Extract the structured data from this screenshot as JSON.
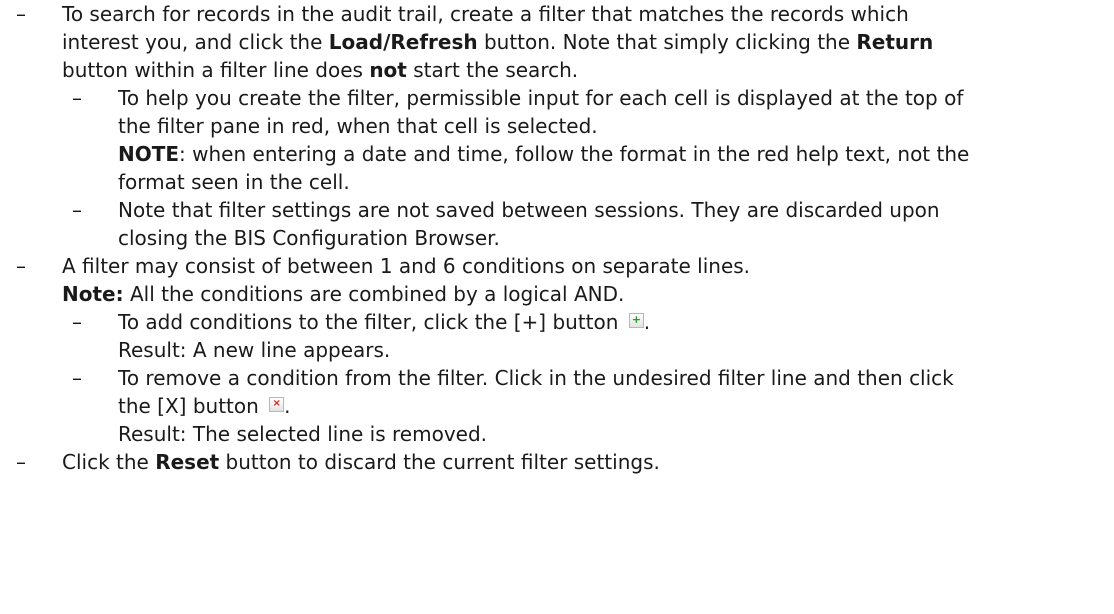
{
  "bullet": "–",
  "items": [
    {
      "lines": [
        [
          "To search for records in the audit trail, create a filter that matches the records which"
        ],
        [
          "interest you, and click the ",
          {
            "b": "Load/Refresh"
          },
          " button. Note that simply clicking the ",
          {
            "b": "Return"
          }
        ],
        [
          "button within a filter line does ",
          {
            "b": "not"
          },
          " start the search."
        ]
      ],
      "sub": [
        {
          "lines": [
            [
              "To help you create the filter, permissible input for each cell is displayed at the top of"
            ],
            [
              "the filter pane in red, when that cell is selected."
            ],
            [
              {
                "b": "NOTE"
              },
              ": when entering a date and time, follow the format in the red help text, not the"
            ],
            [
              "format seen in the cell."
            ]
          ]
        },
        {
          "lines": [
            [
              "Note that filter settings are not saved between sessions. They are discarded upon"
            ],
            [
              "closing the BIS Configuration Browser."
            ]
          ]
        }
      ]
    },
    {
      "lines": [
        [
          "A filter may consist of between 1 and 6 conditions on separate lines."
        ],
        [
          {
            "b": "Note:"
          },
          " All the conditions are combined by a logical AND."
        ]
      ],
      "sub": [
        {
          "lines": [
            [
              "To add conditions to the filter, click the [+] button ",
              {
                "icon": "plus"
              },
              "."
            ],
            [
              "Result: A new line appears."
            ]
          ]
        },
        {
          "lines": [
            [
              "To remove a condition from the filter. Click in the undesired filter line and then click"
            ],
            [
              "the [X] button ",
              {
                "icon": "cross"
              },
              "."
            ],
            [
              "Result: The selected line is removed."
            ]
          ]
        }
      ]
    },
    {
      "lines": [
        [
          "Click the ",
          {
            "b": "Reset"
          },
          " button to discard the current filter settings."
        ]
      ],
      "sub": []
    }
  ],
  "icons": {
    "plus": {
      "name": "plus-button-icon",
      "glyph": "+"
    },
    "cross": {
      "name": "x-button-icon",
      "glyph": "×"
    }
  }
}
